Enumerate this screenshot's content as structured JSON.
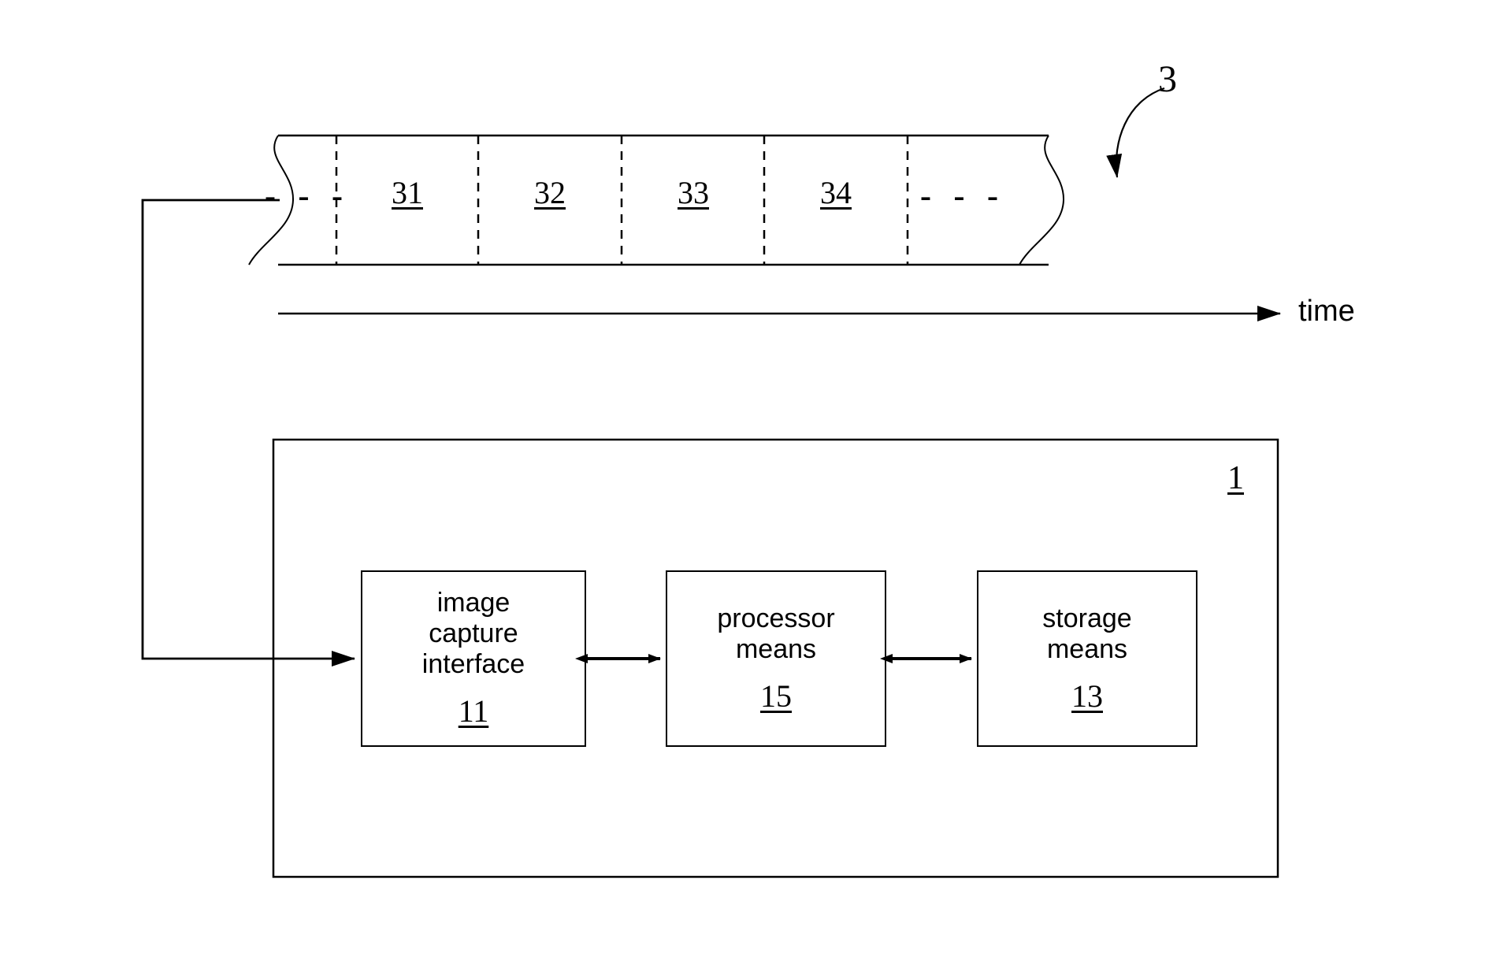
{
  "figure": {
    "type": "patent-block-diagram",
    "frame_sequence": {
      "reference_numeral": "3",
      "time_axis_label": "time",
      "cells": [
        {
          "label": "- - -",
          "kind": "ellipsis"
        },
        {
          "label": "31",
          "kind": "frame"
        },
        {
          "label": "32",
          "kind": "frame"
        },
        {
          "label": "33",
          "kind": "frame"
        },
        {
          "label": "34",
          "kind": "frame"
        },
        {
          "label": "- - -",
          "kind": "ellipsis"
        }
      ]
    },
    "device": {
      "reference_numeral": "1",
      "blocks": [
        {
          "name": "image-capture-interface",
          "lines": [
            "image",
            "capture",
            "interface"
          ],
          "reference_numeral": "11"
        },
        {
          "name": "processor-means",
          "lines": [
            "processor",
            "means"
          ],
          "reference_numeral": "15"
        },
        {
          "name": "storage-means",
          "lines": [
            "storage",
            "means"
          ],
          "reference_numeral": "13"
        }
      ]
    },
    "colors": {
      "stroke": "#000000",
      "background": "#ffffff"
    }
  }
}
